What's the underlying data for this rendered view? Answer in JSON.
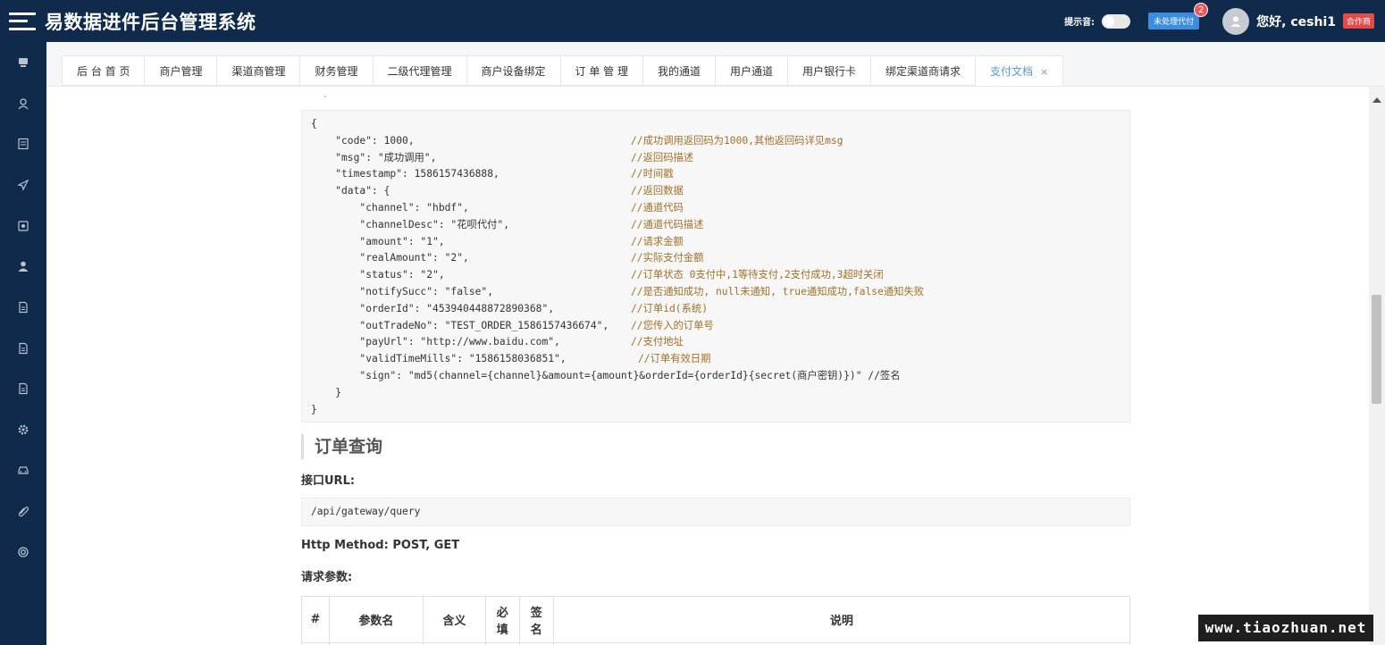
{
  "header": {
    "title": "易数据进件后台管理系统",
    "sound_label": "提示音:",
    "pending_label": "未处理代付",
    "pending_count": "2",
    "greeting": "您好, ceshi1",
    "role_tag": "合作商"
  },
  "sidebar": {
    "icons": [
      "monitor-icon",
      "user-icon",
      "list-icon",
      "send-icon",
      "image-icon",
      "person-icon",
      "document-icon",
      "document-icon",
      "document-icon",
      "gear-icon",
      "car-icon",
      "paperclip-icon",
      "lifebuoy-icon"
    ]
  },
  "tabs": [
    {
      "label": "后 台 首 页"
    },
    {
      "label": "商户管理"
    },
    {
      "label": "渠道商管理"
    },
    {
      "label": "财务管理"
    },
    {
      "label": "二级代理管理"
    },
    {
      "label": "商户设备绑定"
    },
    {
      "label": "订 单 管 理"
    },
    {
      "label": "我的通道"
    },
    {
      "label": "用户通道"
    },
    {
      "label": "用户银行卡"
    },
    {
      "label": "绑定渠道商请求"
    },
    {
      "label": "支付文档",
      "close": "×",
      "active": true
    }
  ],
  "code": {
    "top_dot": "-",
    "lines": [
      {
        "text": "{",
        "comment": ""
      },
      {
        "text": "    \"code\": 1000,",
        "comment": "//成功调用返回码为1000,其他返回码详见msg"
      },
      {
        "text": "    \"msg\": \"成功调用\",",
        "comment": "//返回码描述"
      },
      {
        "text": "    \"timestamp\": 1586157436888,",
        "comment": "//时间戳"
      },
      {
        "text": "    \"data\": {",
        "comment": "//返回数据"
      },
      {
        "text": "        \"channel\": \"hbdf\",",
        "comment": "//通道代码"
      },
      {
        "text": "        \"channelDesc\": \"花呗代付\",",
        "comment": "//通道代码描述"
      },
      {
        "text": "        \"amount\": \"1\",",
        "comment": "//请求金额"
      },
      {
        "text": "        \"realAmount\": \"2\",",
        "comment": "//实际支付金额"
      },
      {
        "text": "        \"status\": \"2\",",
        "comment": "//订单状态 0支付中,1等待支付,2支付成功,3超时关闭"
      },
      {
        "text": "        \"notifySucc\": \"false\",",
        "comment": "//是否通知成功, null未通知, true通知成功,false通知失败"
      },
      {
        "text": "        \"orderId\": \"453940448872890368\",",
        "comment": "//订单id(系统)"
      },
      {
        "text": "        \"outTradeNo\": \"TEST_ORDER_1586157436674\",",
        "comment": "//您传入的订单号"
      },
      {
        "text": "        \"payUrl\": \"http://www.baidu.com\",",
        "comment": "//支付地址"
      },
      {
        "text": "        \"validTimeMills\": \"1586158036851\",",
        "comment": "//订单有效日期"
      },
      {
        "text": "        \"sign\": \"md5(channel={channel}&amount={amount}&orderId={orderId}{secret(商户密钥)})\" //签名",
        "comment": ""
      },
      {
        "text": "    }",
        "comment": ""
      },
      {
        "text": "}",
        "comment": ""
      }
    ]
  },
  "query_section": {
    "title": "订单查询",
    "url_label": "接口URL:",
    "url": "/api/gateway/query",
    "method": "Http Method: POST, GET",
    "params_label": "请求参数:",
    "table_headers": [
      "#",
      "参数名",
      "含义",
      "必\n填",
      "签\n名",
      "说明"
    ]
  },
  "watermark": "www.tiaozhuan.net"
}
